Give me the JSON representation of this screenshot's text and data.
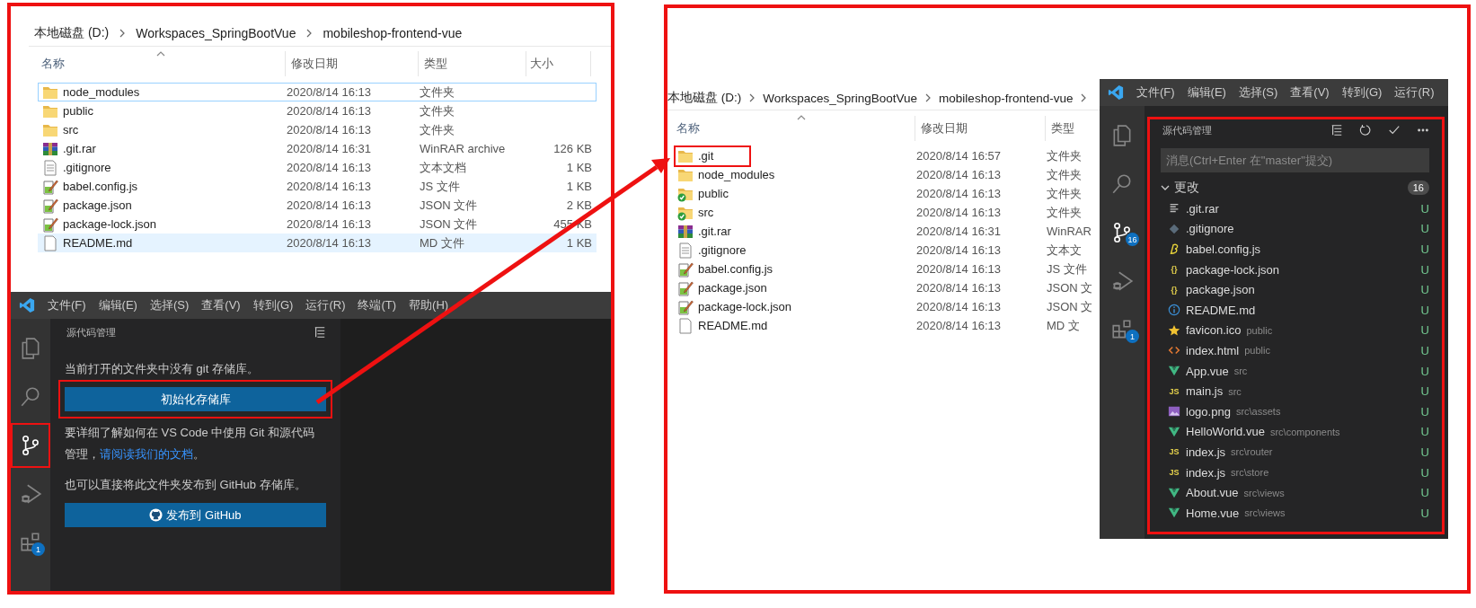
{
  "panels": [
    {
      "annotated": true,
      "explorer": {
        "breadcrumb": [
          "本地磁盘 (D:)",
          "Workspaces_SpringBootVue",
          "mobileshop-frontend-vue"
        ],
        "trailing_separator": false,
        "columns": [
          "名称",
          "修改日期",
          "类型",
          "大小"
        ],
        "rows": [
          {
            "kind": "folder",
            "name": "node_modules",
            "date": "2020/8/14 16:13",
            "type": "文件夹",
            "selected": false,
            "focused": true,
            "annotated": false
          },
          {
            "kind": "folder",
            "name": "public",
            "date": "2020/8/14 16:13",
            "type": "文件夹",
            "selected": false,
            "focused": false,
            "annotated": false
          },
          {
            "kind": "folder",
            "name": "src",
            "date": "2020/8/14 16:13",
            "type": "文件夹",
            "selected": false,
            "focused": false,
            "annotated": false
          },
          {
            "kind": "rar",
            "name": ".git.rar",
            "date": "2020/8/14 16:31",
            "type": "WinRAR archive",
            "size": "126 KB",
            "selected": false,
            "focused": false,
            "annotated": false
          },
          {
            "kind": "text",
            "name": ".gitignore",
            "date": "2020/8/14 16:13",
            "type": "文本文档",
            "size": "1 KB",
            "selected": false,
            "focused": false,
            "annotated": false
          },
          {
            "kind": "script",
            "name": "babel.config.js",
            "date": "2020/8/14 16:13",
            "type": "JS 文件",
            "size": "1 KB",
            "selected": false,
            "focused": false,
            "annotated": false
          },
          {
            "kind": "script",
            "name": "package.json",
            "date": "2020/8/14 16:13",
            "type": "JSON 文件",
            "size": "2 KB",
            "selected": false,
            "focused": false,
            "annotated": false
          },
          {
            "kind": "script",
            "name": "package-lock.json",
            "date": "2020/8/14 16:13",
            "type": "JSON 文件",
            "size": "455 KB",
            "selected": false,
            "focused": false,
            "annotated": false
          },
          {
            "kind": "file",
            "name": "README.md",
            "date": "2020/8/14 16:13",
            "type": "MD 文件",
            "size": "1 KB",
            "selected": true,
            "focused": false,
            "annotated": false
          }
        ]
      },
      "vscode": {
        "menu": [
          "文件(F)",
          "编辑(E)",
          "选择(S)",
          "查看(V)",
          "转到(G)",
          "运行(R)",
          "终端(T)",
          "帮助(H)"
        ],
        "activity": [
          {
            "kind": "files",
            "selected": false,
            "annotated": false
          },
          {
            "kind": "search",
            "selected": false,
            "annotated": false
          },
          {
            "kind": "scm",
            "selected": true,
            "annotated": true
          },
          {
            "kind": "debug",
            "selected": false,
            "annotated": false
          },
          {
            "kind": "extensions",
            "selected": false,
            "annotated": false,
            "badge": "1"
          }
        ],
        "scm": {
          "title": "源代码管理",
          "annotated": false,
          "actions": [
            {
              "kind": "tree"
            }
          ],
          "notice": "当前打开的文件夹中没有 git 存储库。",
          "init_button": {
            "label": "初始化存储库",
            "annotated": true
          },
          "help_text": "要详细了解如何在 VS Code 中使用 Git 和源代码管理，",
          "help_link": "请阅读我们的文档",
          "help_end": "。",
          "publish_text": "也可以直接将此文件夹发布到 GitHub 存储库。",
          "publish_button": "发布到 GitHub"
        }
      }
    },
    {
      "annotated": true,
      "explorer": {
        "breadcrumb": [
          "本地磁盘 (D:)",
          "Workspaces_SpringBootVue",
          "mobileshop-frontend-vue"
        ],
        "trailing_separator": true,
        "columns": [
          "名称",
          "修改日期",
          "类型"
        ],
        "rows": [
          {
            "kind": "folder",
            "name": ".git",
            "date": "2020/8/14 16:57",
            "type": "文件夹",
            "selected": false,
            "focused": false,
            "annotated": true
          },
          {
            "kind": "folder",
            "name": "node_modules",
            "date": "2020/8/14 16:13",
            "type": "文件夹",
            "selected": false,
            "focused": false,
            "annotated": false
          },
          {
            "kind": "folder_synced",
            "name": "public",
            "date": "2020/8/14 16:13",
            "type": "文件夹",
            "selected": false,
            "focused": false,
            "annotated": false
          },
          {
            "kind": "folder_synced",
            "name": "src",
            "date": "2020/8/14 16:13",
            "type": "文件夹",
            "selected": false,
            "focused": false,
            "annotated": false
          },
          {
            "kind": "rar",
            "name": ".git.rar",
            "date": "2020/8/14 16:31",
            "type": "WinRAR",
            "selected": false,
            "focused": false,
            "annotated": false
          },
          {
            "kind": "text",
            "name": ".gitignore",
            "date": "2020/8/14 16:13",
            "type": "文本文",
            "selected": false,
            "focused": false,
            "annotated": false
          },
          {
            "kind": "script",
            "name": "babel.config.js",
            "date": "2020/8/14 16:13",
            "type": "JS 文件",
            "selected": false,
            "focused": false,
            "annotated": false
          },
          {
            "kind": "script",
            "name": "package.json",
            "date": "2020/8/14 16:13",
            "type": "JSON 文",
            "selected": false,
            "focused": false,
            "annotated": false
          },
          {
            "kind": "script",
            "name": "package-lock.json",
            "date": "2020/8/14 16:13",
            "type": "JSON 文",
            "selected": false,
            "focused": false,
            "annotated": false
          },
          {
            "kind": "file",
            "name": "README.md",
            "date": "2020/8/14 16:13",
            "type": "MD 文",
            "selected": false,
            "focused": false,
            "annotated": false
          }
        ]
      },
      "vscode": {
        "menu": [
          "文件(F)",
          "编辑(E)",
          "选择(S)",
          "查看(V)",
          "转到(G)",
          "运行(R)"
        ],
        "activity": [
          {
            "kind": "files",
            "selected": false,
            "annotated": false
          },
          {
            "kind": "search",
            "selected": false,
            "annotated": false
          },
          {
            "kind": "scm",
            "selected": true,
            "annotated": false,
            "badge": "16"
          },
          {
            "kind": "debug",
            "selected": false,
            "annotated": false
          },
          {
            "kind": "extensions",
            "selected": false,
            "annotated": false,
            "badge": "1"
          }
        ],
        "scm": {
          "title": "源代码管理",
          "annotated": true,
          "actions": [
            {
              "kind": "tree"
            },
            {
              "kind": "refresh"
            },
            {
              "kind": "check"
            },
            {
              "kind": "more"
            }
          ],
          "message": {
            "placeholder": "消息(Ctrl+Enter 在\"master\"提交)"
          },
          "section": {
            "title": "更改",
            "expanded": true,
            "count": "16"
          },
          "changes": [
            {
              "kind": "lines",
              "name": ".git.rar",
              "status": "U"
            },
            {
              "kind": "diamond",
              "name": ".gitignore",
              "status": "U"
            },
            {
              "kind": "babel",
              "name": "babel.config.js",
              "status": "U"
            },
            {
              "kind": "json",
              "glyph": "{}",
              "name": "package-lock.json",
              "status": "U"
            },
            {
              "kind": "json",
              "glyph": "{}",
              "name": "package.json",
              "status": "U"
            },
            {
              "kind": "info",
              "name": "README.md",
              "status": "U"
            },
            {
              "kind": "star",
              "name": "favicon.ico",
              "path": "public",
              "status": "U"
            },
            {
              "kind": "html",
              "name": "index.html",
              "path": "public",
              "status": "U"
            },
            {
              "kind": "vue",
              "name": "App.vue",
              "path": "src",
              "status": "U"
            },
            {
              "kind": "js",
              "glyph": "JS",
              "name": "main.js",
              "path": "src",
              "status": "U"
            },
            {
              "kind": "image",
              "name": "logo.png",
              "path": "src\\assets",
              "status": "U"
            },
            {
              "kind": "vue",
              "name": "HelloWorld.vue",
              "path": "src\\components",
              "status": "U"
            },
            {
              "kind": "js",
              "glyph": "JS",
              "name": "index.js",
              "path": "src\\router",
              "status": "U"
            },
            {
              "kind": "js",
              "glyph": "JS",
              "name": "index.js",
              "path": "src\\store",
              "status": "U"
            },
            {
              "kind": "vue",
              "name": "About.vue",
              "path": "src\\views",
              "status": "U"
            },
            {
              "kind": "vue",
              "name": "Home.vue",
              "path": "src\\views",
              "status": "U"
            }
          ]
        }
      }
    }
  ],
  "arrow": {
    "shown": true
  }
}
